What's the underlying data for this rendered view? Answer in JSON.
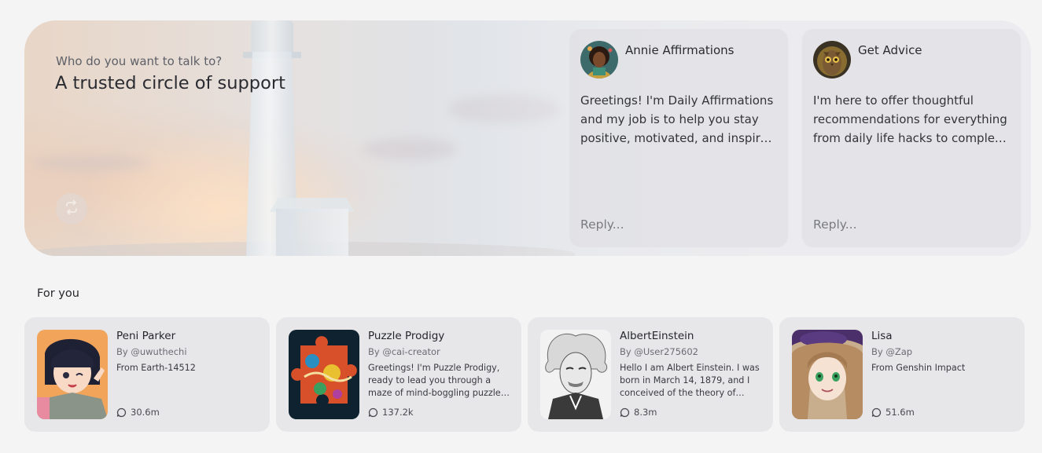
{
  "hero": {
    "subtitle": "Who do you want to talk to?",
    "title": "A trusted circle of support",
    "swap_icon": "swap-icon"
  },
  "chat_cards": [
    {
      "name": "Annie Affirmations",
      "message": "Greetings! I'm Daily Affirmations and my job is to help you stay positive, motivated, and inspired throughout your day.",
      "reply_placeholder": "Reply..."
    },
    {
      "name": "Get Advice",
      "message": "I'm here to offer thoughtful recommendations for everything from daily life hacks to complex decisions.",
      "reply_placeholder": "Reply..."
    }
  ],
  "for_you": {
    "heading": "For you",
    "cards": [
      {
        "title": "Peni Parker",
        "by": "By @uwuthechi",
        "description": "From Earth-14512",
        "interactions": "30.6m"
      },
      {
        "title": "Puzzle Prodigy",
        "by": "By @cai-creator",
        "description": "Greetings! I'm Puzzle Prodigy, ready to lead you through a maze of mind-boggling puzzles and riddles.",
        "interactions": "137.2k"
      },
      {
        "title": "AlbertEinstein",
        "by": "By @User275602",
        "description": "Hello I am Albert Einstein. I was born in March 14, 1879, and I conceived of the theory of relativity.",
        "interactions": "8.3m"
      },
      {
        "title": "Lisa",
        "by": "By @Zap",
        "description": "From Genshin Impact",
        "interactions": "51.6m"
      }
    ]
  }
}
